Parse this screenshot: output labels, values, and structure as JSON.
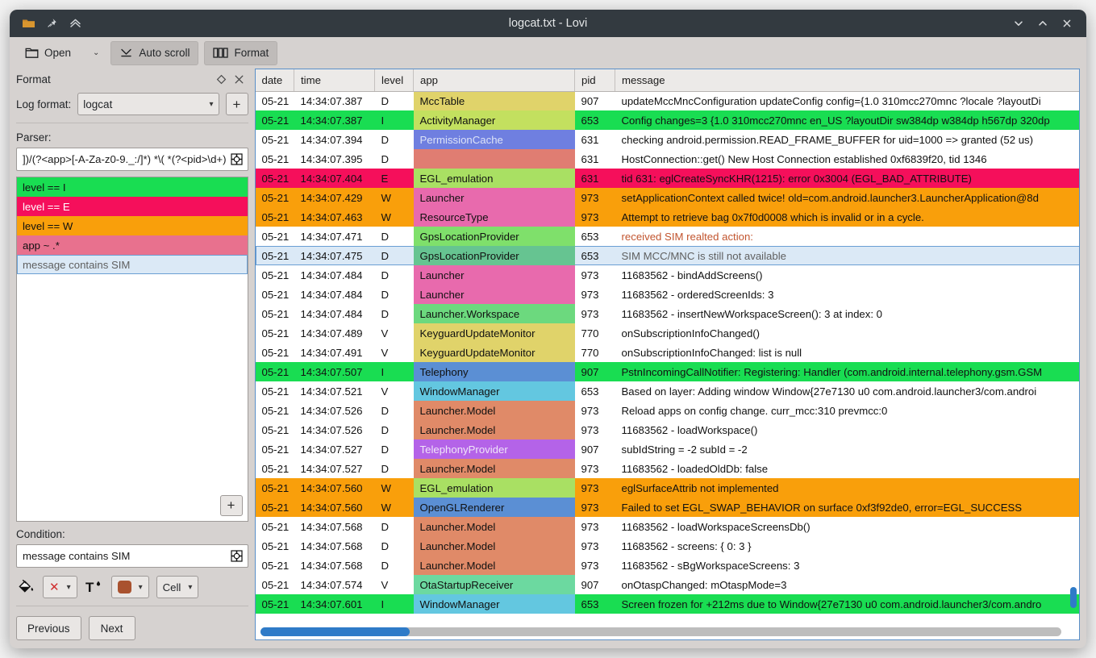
{
  "window": {
    "title": "logcat.txt - Lovi",
    "titlebar_icons": [
      "folder-icon",
      "pin-icon",
      "collapse-icon"
    ],
    "controls": [
      "minimize-button",
      "maximize-button",
      "close-button"
    ]
  },
  "toolbar": {
    "open_label": "Open",
    "open_caret": "⌄",
    "auto_scroll_label": "Auto scroll",
    "format_label": "Format"
  },
  "dock": {
    "title": "Format",
    "float_icon": "float-icon",
    "close_icon": "close-icon",
    "log_format_label": "Log format:",
    "log_format_value": "logcat",
    "log_format_options": [
      "logcat"
    ],
    "add_format_label": "+",
    "parser_label": "Parser:",
    "parser_value": "])/(?<app>[-A-Za-z0-9._:/]*) *\\( *(?<pid>\\d+)",
    "parser_icon": "pattern-icon",
    "rules": [
      {
        "text": "level == I",
        "bg": "#19dd52",
        "fg": "#111111",
        "selected": false
      },
      {
        "text": "level == E",
        "bg": "#f50f5b",
        "fg": "#ffffff",
        "selected": false
      },
      {
        "text": "level == W",
        "bg": "#f99f0b",
        "fg": "#111111",
        "selected": false
      },
      {
        "text": "app ~ .*",
        "bg": "#e8718e",
        "fg": "#111111",
        "selected": false
      },
      {
        "text": "message contains SIM",
        "bg": "#dbe9f6",
        "fg": "#5f5f5f",
        "selected": true
      }
    ],
    "rule_add_label": "+",
    "condition_label": "Condition:",
    "condition_value": "message contains SIM",
    "condition_icon": "pattern-icon",
    "fill_icon": "paint-bucket-icon",
    "bg_color_value": "✕",
    "bg_color_caret": "⌄",
    "text_color_icon": "text-color-icon",
    "fg_color_swatch": "#a9522f",
    "fg_color_caret": "⌄",
    "scope_value": "Cell",
    "scope_caret": "⌄",
    "previous_label": "Previous",
    "next_label": "Next"
  },
  "table": {
    "columns": [
      "date",
      "time",
      "level",
      "app",
      "pid",
      "message"
    ],
    "h_scroll_percent": 17,
    "rows": [
      {
        "date": "05-21",
        "time": "14:34:07.387",
        "level": "D",
        "app": "MccTable",
        "pid": "907",
        "message": "updateMccMncConfiguration updateConfig config={1.0 310mcc270mnc ?locale ?layoutDi",
        "row_bg": "#ffffff",
        "row_fg": "#111111",
        "app_bg": "#e0d36a",
        "app_fg": "#111111",
        "selected": false
      },
      {
        "date": "05-21",
        "time": "14:34:07.387",
        "level": "I",
        "app": "ActivityManager",
        "pid": "653",
        "message": "Config changes=3 {1.0 310mcc270mnc en_US ?layoutDir sw384dp w384dp h567dp 320dp",
        "row_bg": "#19dd52",
        "row_fg": "#111111",
        "app_bg": "#c3e05f",
        "app_fg": "#111111",
        "selected": false
      },
      {
        "date": "05-21",
        "time": "14:34:07.394",
        "level": "D",
        "app": "PermissionCache",
        "pid": "631",
        "message": "checking android.permission.READ_FRAME_BUFFER for uid=1000 => granted (52 us)",
        "row_bg": "#ffffff",
        "row_fg": "#111111",
        "app_bg": "#6f7fe0",
        "app_fg": "#dce3f7",
        "selected": false
      },
      {
        "date": "05-21",
        "time": "14:34:07.395",
        "level": "D",
        "app": "",
        "pid": "631",
        "message": "HostConnection::get() New Host Connection established 0xf6839f20, tid 1346",
        "row_bg": "#ffffff",
        "row_fg": "#111111",
        "app_bg": "#e07d72",
        "app_fg": "#111111",
        "selected": false
      },
      {
        "date": "05-21",
        "time": "14:34:07.404",
        "level": "E",
        "app": "EGL_emulation",
        "pid": "631",
        "message": "tid 631: eglCreateSyncKHR(1215): error 0x3004 (EGL_BAD_ATTRIBUTE)",
        "row_bg": "#f50f5b",
        "row_fg": "#ffffff",
        "app_bg": "#a9e063",
        "app_fg": "#111111",
        "selected": false
      },
      {
        "date": "05-21",
        "time": "14:34:07.429",
        "level": "W",
        "app": "Launcher",
        "pid": "973",
        "message": "setApplicationContext called twice! old=com.android.launcher3.LauncherApplication@8d",
        "row_bg": "#f99f0b",
        "row_fg": "#111111",
        "app_bg": "#e86aad",
        "app_fg": "#111111",
        "selected": false
      },
      {
        "date": "05-21",
        "time": "14:34:07.463",
        "level": "W",
        "app": "ResourceType",
        "pid": "973",
        "message": "Attempt to retrieve bag 0x7f0d0008 which is invalid or in a cycle.",
        "row_bg": "#f99f0b",
        "row_fg": "#111111",
        "app_bg": "#e86aad",
        "app_fg": "#111111",
        "selected": false
      },
      {
        "date": "05-21",
        "time": "14:34:07.471",
        "level": "D",
        "app": "GpsLocationProvider",
        "pid": "653",
        "message": "received SIM realted action:",
        "row_bg": "#ffffff",
        "row_fg": "#111111",
        "app_bg": "#7fe06b",
        "app_fg": "#111111",
        "msg_fg": "#c2552f",
        "selected": false
      },
      {
        "date": "05-21",
        "time": "14:34:07.475",
        "level": "D",
        "app": "GpsLocationProvider",
        "pid": "653",
        "message": "SIM MCC/MNC is still not available",
        "row_bg": "#dbe9f6",
        "row_fg": "#111111",
        "app_bg": "#66c491",
        "app_fg": "#111111",
        "msg_fg": "#5f5f5f",
        "selected": true
      },
      {
        "date": "05-21",
        "time": "14:34:07.484",
        "level": "D",
        "app": "Launcher",
        "pid": "973",
        "message": "11683562 - bindAddScreens()",
        "row_bg": "#ffffff",
        "row_fg": "#111111",
        "app_bg": "#e86aad",
        "app_fg": "#111111",
        "selected": false
      },
      {
        "date": "05-21",
        "time": "14:34:07.484",
        "level": "D",
        "app": "Launcher",
        "pid": "973",
        "message": "11683562 -   orderedScreenIds: 3",
        "row_bg": "#ffffff",
        "row_fg": "#111111",
        "app_bg": "#e86aad",
        "app_fg": "#111111",
        "selected": false
      },
      {
        "date": "05-21",
        "time": "14:34:07.484",
        "level": "D",
        "app": "Launcher.Workspace",
        "pid": "973",
        "message": "11683562 - insertNewWorkspaceScreen(): 3 at index: 0",
        "row_bg": "#ffffff",
        "row_fg": "#111111",
        "app_bg": "#6cd97e",
        "app_fg": "#111111",
        "selected": false
      },
      {
        "date": "05-21",
        "time": "14:34:07.489",
        "level": "V",
        "app": "KeyguardUpdateMonitor",
        "pid": "770",
        "message": "onSubscriptionInfoChanged()",
        "row_bg": "#ffffff",
        "row_fg": "#111111",
        "app_bg": "#e0d36a",
        "app_fg": "#111111",
        "selected": false
      },
      {
        "date": "05-21",
        "time": "14:34:07.491",
        "level": "V",
        "app": "KeyguardUpdateMonitor",
        "pid": "770",
        "message": "onSubscriptionInfoChanged: list is null",
        "row_bg": "#ffffff",
        "row_fg": "#111111",
        "app_bg": "#e0d36a",
        "app_fg": "#111111",
        "selected": false
      },
      {
        "date": "05-21",
        "time": "14:34:07.507",
        "level": "I",
        "app": "Telephony",
        "pid": "907",
        "message": "PstnIncomingCallNotifier: Registering: Handler (com.android.internal.telephony.gsm.GSM",
        "row_bg": "#19dd52",
        "row_fg": "#111111",
        "app_bg": "#5b8fd4",
        "app_fg": "#111111",
        "selected": false
      },
      {
        "date": "05-21",
        "time": "14:34:07.521",
        "level": "V",
        "app": "WindowManager",
        "pid": "653",
        "message": "Based on layer: Adding window Window{27e7130 u0 com.android.launcher3/com.androi",
        "row_bg": "#ffffff",
        "row_fg": "#111111",
        "app_bg": "#63c7e0",
        "app_fg": "#111111",
        "selected": false
      },
      {
        "date": "05-21",
        "time": "14:34:07.526",
        "level": "D",
        "app": "Launcher.Model",
        "pid": "973",
        "message": "Reload apps on config change. curr_mcc:310 prevmcc:0",
        "row_bg": "#ffffff",
        "row_fg": "#111111",
        "app_bg": "#e08a68",
        "app_fg": "#111111",
        "selected": false
      },
      {
        "date": "05-21",
        "time": "14:34:07.526",
        "level": "D",
        "app": "Launcher.Model",
        "pid": "973",
        "message": "11683562 - loadWorkspace()",
        "row_bg": "#ffffff",
        "row_fg": "#111111",
        "app_bg": "#e08a68",
        "app_fg": "#111111",
        "selected": false
      },
      {
        "date": "05-21",
        "time": "14:34:07.527",
        "level": "D",
        "app": "TelephonyProvider",
        "pid": "907",
        "message": "subIdString = -2 subId = -2",
        "row_bg": "#ffffff",
        "row_fg": "#111111",
        "app_bg": "#b463e8",
        "app_fg": "#f0e6f8",
        "selected": false
      },
      {
        "date": "05-21",
        "time": "14:34:07.527",
        "level": "D",
        "app": "Launcher.Model",
        "pid": "973",
        "message": "11683562 -   loadedOldDb: false",
        "row_bg": "#ffffff",
        "row_fg": "#111111",
        "app_bg": "#e08a68",
        "app_fg": "#111111",
        "selected": false
      },
      {
        "date": "05-21",
        "time": "14:34:07.560",
        "level": "W",
        "app": "EGL_emulation",
        "pid": "973",
        "message": "eglSurfaceAttrib not implemented",
        "row_bg": "#f99f0b",
        "row_fg": "#111111",
        "app_bg": "#a9e063",
        "app_fg": "#111111",
        "selected": false
      },
      {
        "date": "05-21",
        "time": "14:34:07.560",
        "level": "W",
        "app": "OpenGLRenderer",
        "pid": "973",
        "message": "Failed to set EGL_SWAP_BEHAVIOR on surface 0xf3f92de0, error=EGL_SUCCESS",
        "row_bg": "#f99f0b",
        "row_fg": "#111111",
        "app_bg": "#5b8fd4",
        "app_fg": "#111111",
        "selected": false
      },
      {
        "date": "05-21",
        "time": "14:34:07.568",
        "level": "D",
        "app": "Launcher.Model",
        "pid": "973",
        "message": "11683562 - loadWorkspaceScreensDb()",
        "row_bg": "#ffffff",
        "row_fg": "#111111",
        "app_bg": "#e08a68",
        "app_fg": "#111111",
        "selected": false
      },
      {
        "date": "05-21",
        "time": "14:34:07.568",
        "level": "D",
        "app": "Launcher.Model",
        "pid": "973",
        "message": "11683562 -   screens: { 0: 3 }",
        "row_bg": "#ffffff",
        "row_fg": "#111111",
        "app_bg": "#e08a68",
        "app_fg": "#111111",
        "selected": false
      },
      {
        "date": "05-21",
        "time": "14:34:07.568",
        "level": "D",
        "app": "Launcher.Model",
        "pid": "973",
        "message": "11683562 -   sBgWorkspaceScreens: 3",
        "row_bg": "#ffffff",
        "row_fg": "#111111",
        "app_bg": "#e08a68",
        "app_fg": "#111111",
        "selected": false
      },
      {
        "date": "05-21",
        "time": "14:34:07.574",
        "level": "V",
        "app": "OtaStartupReceiver",
        "pid": "907",
        "message": "onOtaspChanged: mOtaspMode=3",
        "row_bg": "#ffffff",
        "row_fg": "#111111",
        "app_bg": "#6cd9a0",
        "app_fg": "#111111",
        "selected": false
      },
      {
        "date": "05-21",
        "time": "14:34:07.601",
        "level": "I",
        "app": "WindowManager",
        "pid": "653",
        "message": "Screen frozen for +212ms due to Window{27e7130 u0 com.android.launcher3/com.andro",
        "row_bg": "#19dd52",
        "row_fg": "#111111",
        "app_bg": "#63c7e0",
        "app_fg": "#111111",
        "selected": false
      }
    ]
  }
}
